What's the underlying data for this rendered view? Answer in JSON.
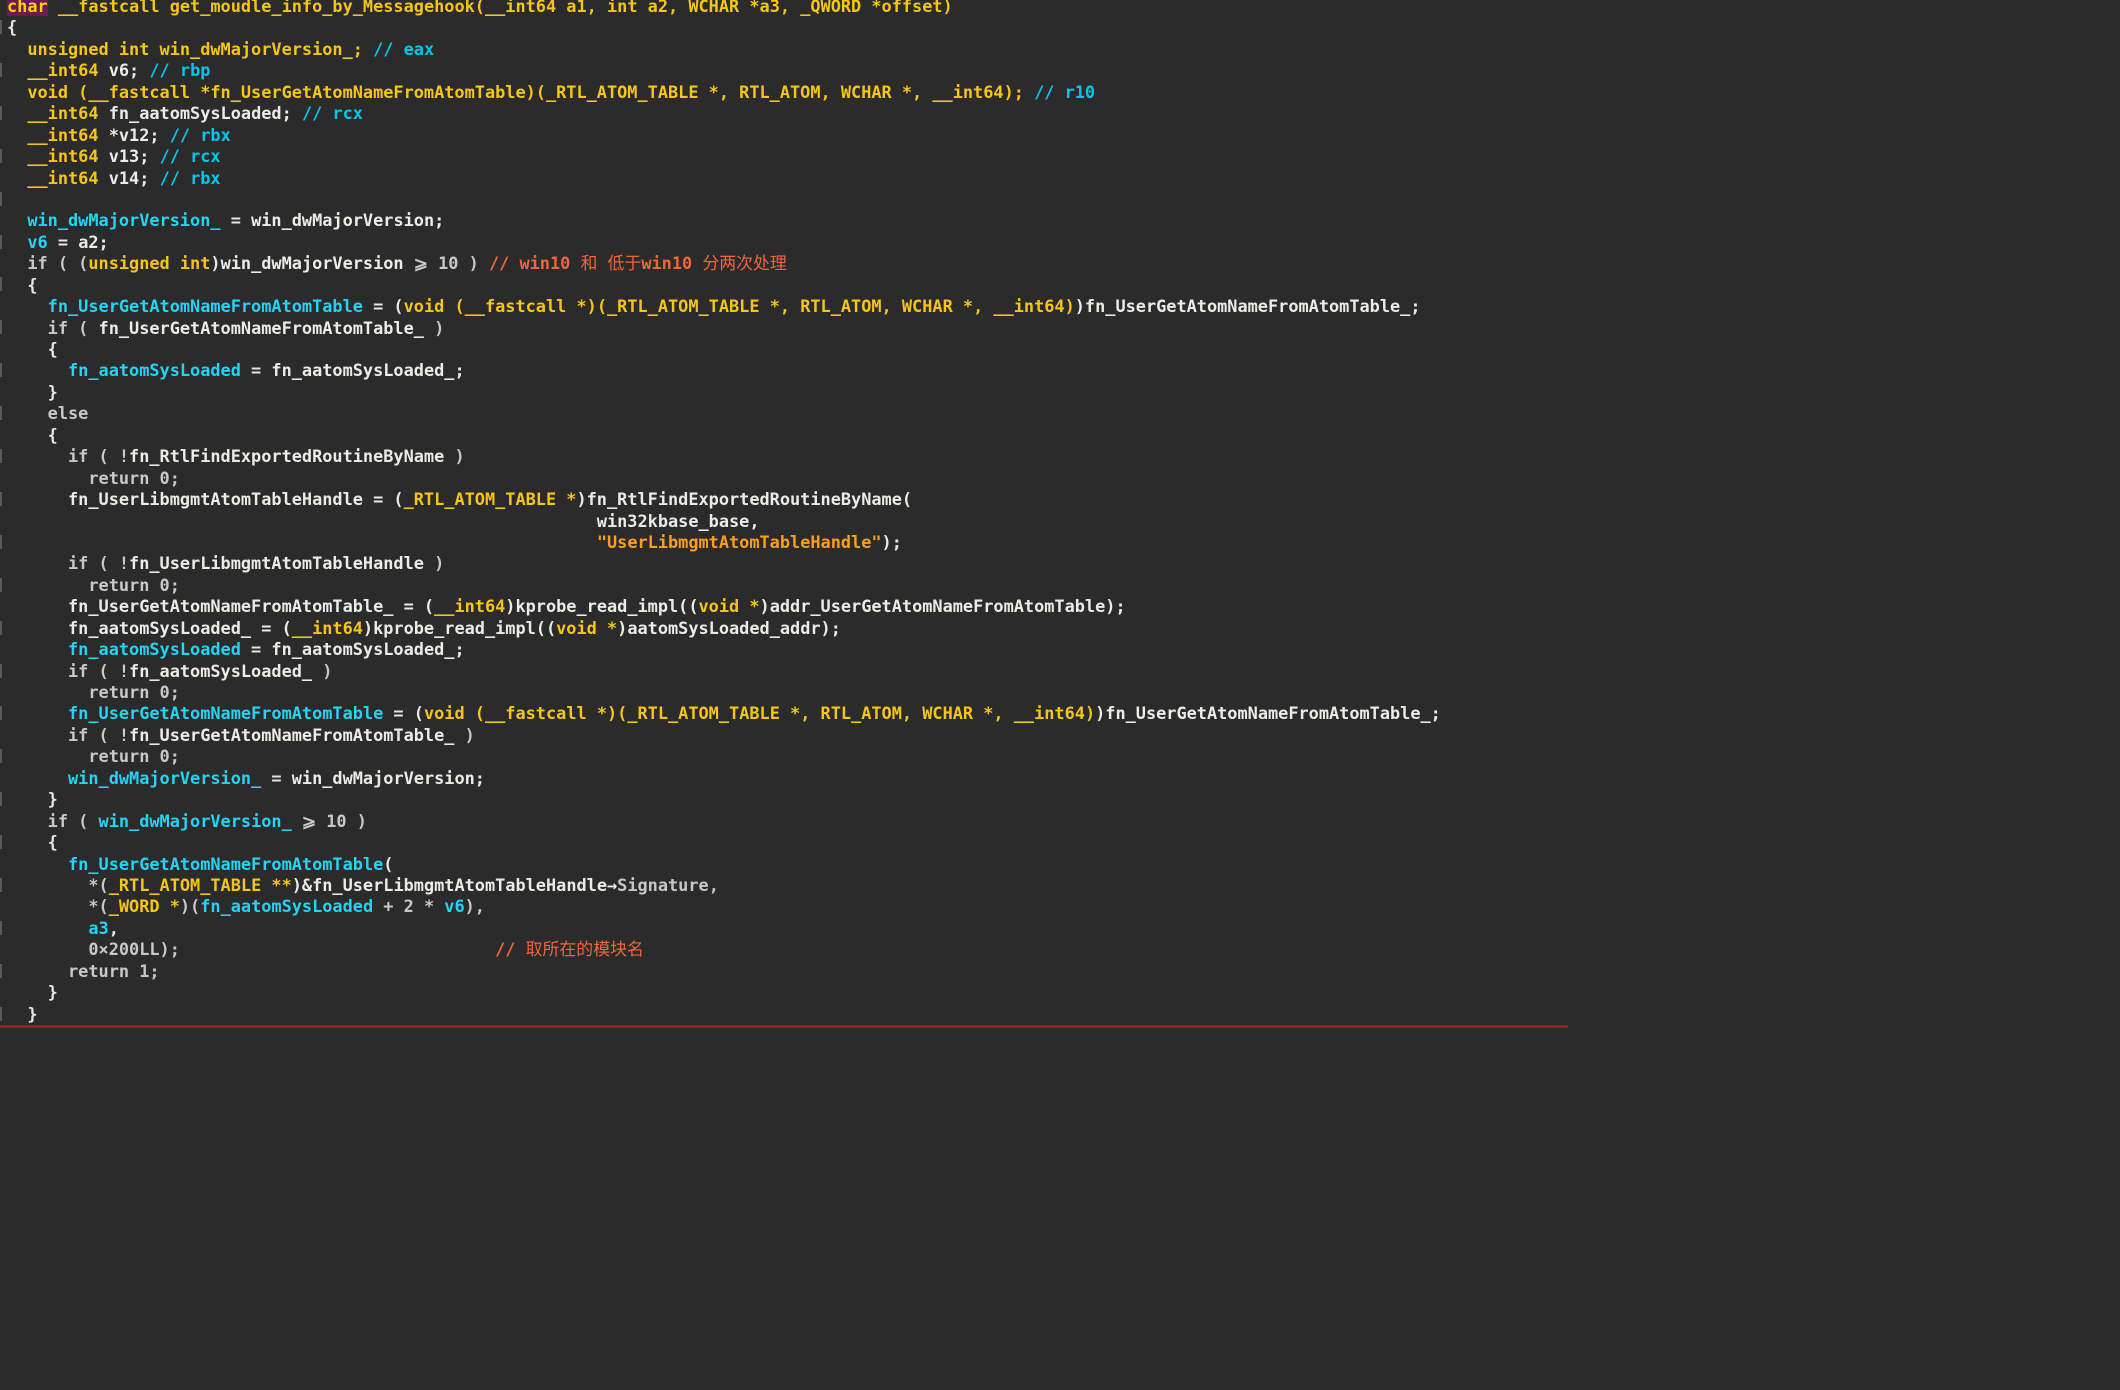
{
  "colors": {
    "background": "#2b2b2b",
    "keyword": "#c8c8c8",
    "type": "#f5c518",
    "global_variable": "#24d4f4",
    "comment": "#f0653c",
    "register_comment": "#00c8ec",
    "string": "#ff9d1e",
    "identifier": "#ecebe4",
    "selection_highlight": "#6b1a55"
  },
  "code": {
    "lines": [
      [
        {
          "t": "char",
          "c": "hl"
        },
        {
          "t": " __fastcall get_moudle_info_by_Messagehook(__int64 a1, int a2, WCHAR *a3, _QWORD *offset)",
          "c": "ty"
        }
      ],
      [
        {
          "t": "{",
          "c": "op"
        }
      ],
      [
        {
          "t": "  unsigned int win_dwMajorVersion_; ",
          "c": "ty"
        },
        {
          "t": "// eax",
          "c": "gcm"
        }
      ],
      [
        {
          "t": "  __int64 ",
          "c": "ty"
        },
        {
          "t": "v6; ",
          "c": "fn"
        },
        {
          "t": "// rbp",
          "c": "gcm"
        }
      ],
      [
        {
          "t": "  void (__fastcall *fn_UserGetAtomNameFromAtomTable)(_RTL_ATOM_TABLE *, RTL_ATOM, WCHAR *, __int64); ",
          "c": "ty"
        },
        {
          "t": "// r10",
          "c": "gcm"
        }
      ],
      [
        {
          "t": "  __int64 ",
          "c": "ty"
        },
        {
          "t": "fn_aatomSysLoaded; ",
          "c": "fn"
        },
        {
          "t": "// rcx",
          "c": "gcm"
        }
      ],
      [
        {
          "t": "  __int64 ",
          "c": "ty"
        },
        {
          "t": "*v12; ",
          "c": "fn"
        },
        {
          "t": "// rbx",
          "c": "gcm"
        }
      ],
      [
        {
          "t": "  __int64 ",
          "c": "ty"
        },
        {
          "t": "v13; ",
          "c": "fn"
        },
        {
          "t": "// rcx",
          "c": "gcm"
        }
      ],
      [
        {
          "t": "  __int64 ",
          "c": "ty"
        },
        {
          "t": "v14; ",
          "c": "fn"
        },
        {
          "t": "// rbx",
          "c": "gcm"
        }
      ],
      [
        {
          "t": "",
          "c": "op"
        }
      ],
      [
        {
          "t": "  win_dwMajorVersion_",
          "c": "var"
        },
        {
          "t": " = ",
          "c": "op"
        },
        {
          "t": "win_dwMajorVersion;",
          "c": "fn"
        }
      ],
      [
        {
          "t": "  v6",
          "c": "var"
        },
        {
          "t": " = ",
          "c": "op"
        },
        {
          "t": "a2;",
          "c": "fn"
        }
      ],
      [
        {
          "t": "  if ( (",
          "c": "kw"
        },
        {
          "t": "unsigned int",
          "c": "ty"
        },
        {
          "t": ")",
          "c": "op"
        },
        {
          "t": "win_dwMajorVersion",
          "c": "fn"
        },
        {
          "t": " ⩾ 10 ) ",
          "c": "kw"
        },
        {
          "t": "// win10 ",
          "c": "cm"
        },
        {
          "t": "和",
          "c": "cm",
          "cjk": true
        },
        {
          "t": " ",
          "c": "cm"
        },
        {
          "t": "低于",
          "c": "cm",
          "cjk": true
        },
        {
          "t": "win10 ",
          "c": "cm"
        },
        {
          "t": "分两次处理",
          "c": "cm",
          "cjk": true
        }
      ],
      [
        {
          "t": "  {",
          "c": "op"
        }
      ],
      [
        {
          "t": "    fn_UserGetAtomNameFromAtomTable",
          "c": "var"
        },
        {
          "t": " = (",
          "c": "op"
        },
        {
          "t": "void (__fastcall *)(_RTL_ATOM_TABLE *, RTL_ATOM, WCHAR *, __int64)",
          "c": "ty"
        },
        {
          "t": ")fn_UserGetAtomNameFromAtomTable_;",
          "c": "fn"
        }
      ],
      [
        {
          "t": "    if ( ",
          "c": "kw"
        },
        {
          "t": "fn_UserGetAtomNameFromAtomTable_",
          "c": "fn"
        },
        {
          "t": " )",
          "c": "kw"
        }
      ],
      [
        {
          "t": "    {",
          "c": "op"
        }
      ],
      [
        {
          "t": "      fn_aatomSysLoaded",
          "c": "var"
        },
        {
          "t": " = ",
          "c": "op"
        },
        {
          "t": "fn_aatomSysLoaded_;",
          "c": "fn"
        }
      ],
      [
        {
          "t": "    }",
          "c": "op"
        }
      ],
      [
        {
          "t": "    else",
          "c": "kw"
        }
      ],
      [
        {
          "t": "    {",
          "c": "op"
        }
      ],
      [
        {
          "t": "      if ( !",
          "c": "kw"
        },
        {
          "t": "fn_RtlFindExportedRoutineByName",
          "c": "fn"
        },
        {
          "t": " )",
          "c": "kw"
        }
      ],
      [
        {
          "t": "        return 0;",
          "c": "kw"
        }
      ],
      [
        {
          "t": "      fn_UserLibmgmtAtomTableHandle = (",
          "c": "fn"
        },
        {
          "t": "_RTL_ATOM_TABLE *",
          "c": "ty"
        },
        {
          "t": ")fn_RtlFindExportedRoutineByName(",
          "c": "fn"
        }
      ],
      [
        {
          "t": "                                                          win32kbase_base,",
          "c": "fn"
        }
      ],
      [
        {
          "t": "                                                          ",
          "c": "op"
        },
        {
          "t": "\"UserLibmgmtAtomTableHandle\"",
          "c": "str"
        },
        {
          "t": ");",
          "c": "fn"
        }
      ],
      [
        {
          "t": "      if ( !",
          "c": "kw"
        },
        {
          "t": "fn_UserLibmgmtAtomTableHandle",
          "c": "fn"
        },
        {
          "t": " )",
          "c": "kw"
        }
      ],
      [
        {
          "t": "        return 0;",
          "c": "kw"
        }
      ],
      [
        {
          "t": "      fn_UserGetAtomNameFromAtomTable_ = (",
          "c": "fn"
        },
        {
          "t": "__int64",
          "c": "ty"
        },
        {
          "t": ")kprobe_read_impl((",
          "c": "fn"
        },
        {
          "t": "void *",
          "c": "ty"
        },
        {
          "t": ")addr_UserGetAtomNameFromAtomTable);",
          "c": "fn"
        }
      ],
      [
        {
          "t": "      fn_aatomSysLoaded_ = (",
          "c": "fn"
        },
        {
          "t": "__int64",
          "c": "ty"
        },
        {
          "t": ")kprobe_read_impl((",
          "c": "fn"
        },
        {
          "t": "void *",
          "c": "ty"
        },
        {
          "t": ")aatomSysLoaded_addr);",
          "c": "fn"
        }
      ],
      [
        {
          "t": "      fn_aatomSysLoaded",
          "c": "var"
        },
        {
          "t": " = ",
          "c": "op"
        },
        {
          "t": "fn_aatomSysLoaded_;",
          "c": "fn"
        }
      ],
      [
        {
          "t": "      if ( !",
          "c": "kw"
        },
        {
          "t": "fn_aatomSysLoaded_",
          "c": "fn"
        },
        {
          "t": " )",
          "c": "kw"
        }
      ],
      [
        {
          "t": "        return 0;",
          "c": "kw"
        }
      ],
      [
        {
          "t": "      fn_UserGetAtomNameFromAtomTable",
          "c": "var"
        },
        {
          "t": " = (",
          "c": "op"
        },
        {
          "t": "void (__fastcall *)(_RTL_ATOM_TABLE *, RTL_ATOM, WCHAR *, __int64)",
          "c": "ty"
        },
        {
          "t": ")fn_UserGetAtomNameFromAtomTable_;",
          "c": "fn"
        }
      ],
      [
        {
          "t": "      if ( !",
          "c": "kw"
        },
        {
          "t": "fn_UserGetAtomNameFromAtomTable_",
          "c": "fn"
        },
        {
          "t": " )",
          "c": "kw"
        }
      ],
      [
        {
          "t": "        return 0;",
          "c": "kw"
        }
      ],
      [
        {
          "t": "      win_dwMajorVersion_",
          "c": "var"
        },
        {
          "t": " = ",
          "c": "op"
        },
        {
          "t": "win_dwMajorVersion;",
          "c": "fn"
        }
      ],
      [
        {
          "t": "    }",
          "c": "op"
        }
      ],
      [
        {
          "t": "    if ( ",
          "c": "kw"
        },
        {
          "t": "win_dwMajorVersion_",
          "c": "var"
        },
        {
          "t": " ⩾ 10 )",
          "c": "kw"
        }
      ],
      [
        {
          "t": "    {",
          "c": "op"
        }
      ],
      [
        {
          "t": "      fn_UserGetAtomNameFromAtomTable",
          "c": "var"
        },
        {
          "t": "(",
          "c": "op"
        }
      ],
      [
        {
          "t": "        *(",
          "c": "kw"
        },
        {
          "t": "_RTL_ATOM_TABLE **",
          "c": "ty"
        },
        {
          "t": ")&fn_UserLibmgmtAtomTableHandle→",
          "c": "fn"
        },
        {
          "t": "Signature,",
          "c": "kw"
        }
      ],
      [
        {
          "t": "        *(",
          "c": "kw"
        },
        {
          "t": "_WORD *",
          "c": "ty"
        },
        {
          "t": ")(",
          "c": "kw"
        },
        {
          "t": "fn_aatomSysLoaded",
          "c": "var"
        },
        {
          "t": " + 2 * ",
          "c": "kw"
        },
        {
          "t": "v6",
          "c": "var"
        },
        {
          "t": "),",
          "c": "kw"
        }
      ],
      [
        {
          "t": "        a3",
          "c": "var"
        },
        {
          "t": ",",
          "c": "op"
        }
      ],
      [
        {
          "t": "        0×200LL);                               ",
          "c": "kw"
        },
        {
          "t": "// ",
          "c": "cm"
        },
        {
          "t": "取所在的模块名",
          "c": "cm",
          "cjk": true
        }
      ],
      [
        {
          "t": "      return 1;",
          "c": "kw"
        }
      ],
      [
        {
          "t": "    }",
          "c": "op"
        }
      ],
      [
        {
          "t": "  }",
          "c": "op"
        }
      ]
    ]
  }
}
